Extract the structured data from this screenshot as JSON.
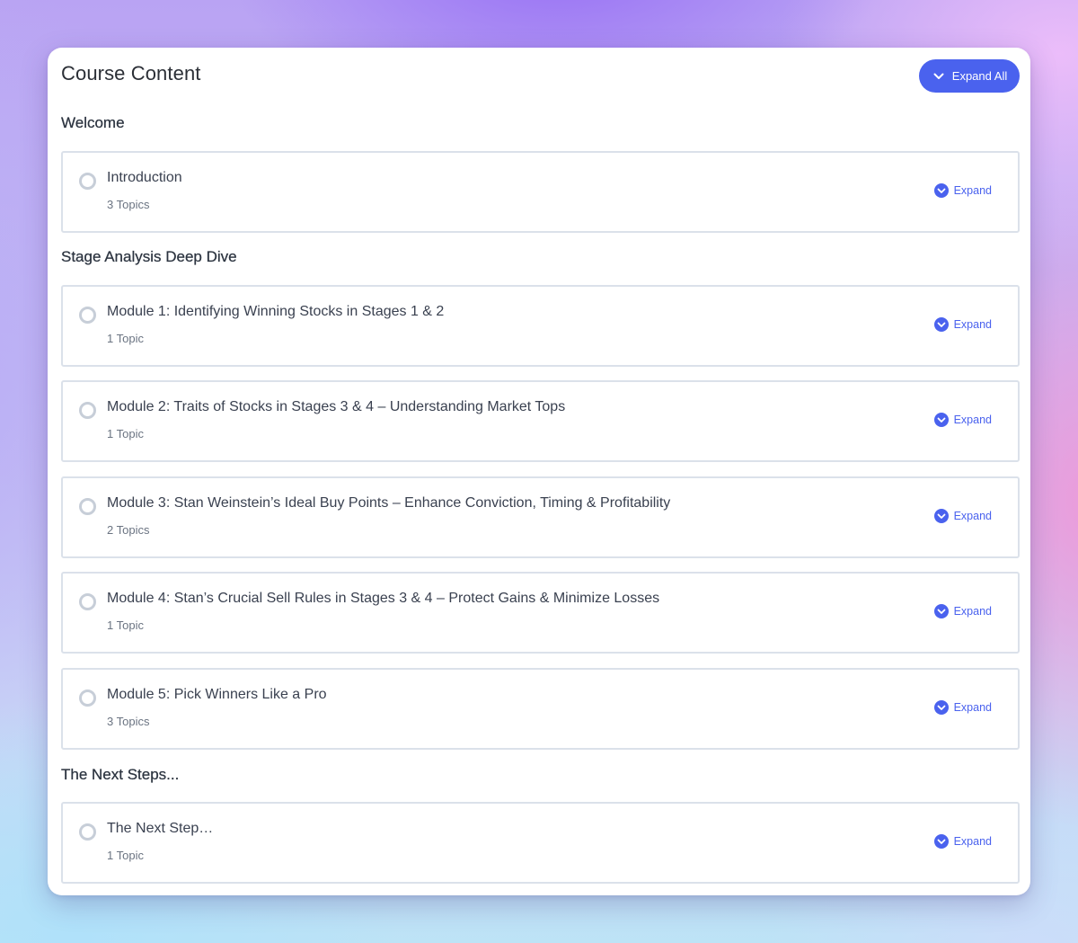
{
  "page": {
    "title": "Course Content",
    "expand_all_label": "Expand All",
    "accent_color": "#4a62ee"
  },
  "sections": [
    {
      "heading": "Welcome",
      "lessons": [
        {
          "title": "Introduction",
          "topics": "3 Topics",
          "expand_label": "Expand"
        }
      ]
    },
    {
      "heading": "Stage Analysis Deep Dive",
      "lessons": [
        {
          "title": "Module 1: Identifying Winning Stocks in Stages 1 & 2",
          "topics": "1 Topic",
          "expand_label": "Expand"
        },
        {
          "title": "Module 2: Traits of Stocks in Stages 3 & 4 – Understanding Market Tops",
          "topics": "1 Topic",
          "expand_label": "Expand"
        },
        {
          "title": "Module 3: Stan Weinstein’s Ideal Buy Points – Enhance Conviction, Timing & Profitability",
          "topics": "2 Topics",
          "expand_label": "Expand"
        },
        {
          "title": "Module 4: Stan’s Crucial Sell Rules in Stages 3 & 4 – Protect Gains & Minimize Losses",
          "topics": "1 Topic",
          "expand_label": "Expand"
        },
        {
          "title": "Module 5: Pick Winners Like a Pro",
          "topics": "3 Topics",
          "expand_label": "Expand"
        }
      ]
    },
    {
      "heading": "The Next Steps...",
      "lessons": [
        {
          "title": "The Next Step…",
          "topics": "1 Topic",
          "expand_label": "Expand"
        }
      ]
    }
  ]
}
